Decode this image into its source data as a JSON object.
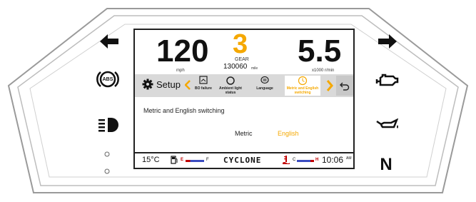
{
  "cluster": {
    "speed_value": "120",
    "speed_unit": "mph",
    "gear_value": "3",
    "gear_label": "GEAR",
    "odometer_value": "130060",
    "odometer_unit": "mile",
    "rpm_value": "5.5",
    "rpm_unit": "x1000 r/min"
  },
  "menu": {
    "setup_label": "Setup",
    "items": [
      {
        "label": "BO failure",
        "icon": "fault-icon"
      },
      {
        "label": "Ambient light status",
        "icon": "light-ring-icon"
      },
      {
        "label": "Language",
        "icon": "chat-bubble-icon"
      },
      {
        "label": "Metric and English switching",
        "icon": "clock-icon"
      }
    ]
  },
  "content": {
    "title": "Metric and English switching",
    "option_metric": "Metric",
    "option_english": "English"
  },
  "status": {
    "temperature": "15°C",
    "fuel_empty": "E",
    "fuel_full": "F",
    "brand": "CYCLONE",
    "temp_cold": "C",
    "temp_hot": "H",
    "time": "10:06",
    "ampm": "AM"
  },
  "side": {
    "abs": "ABS",
    "gear_indicator": "N"
  },
  "colors": {
    "accent": "#f5a800",
    "bezel": "#9a9a9a",
    "icon": "#111111"
  }
}
